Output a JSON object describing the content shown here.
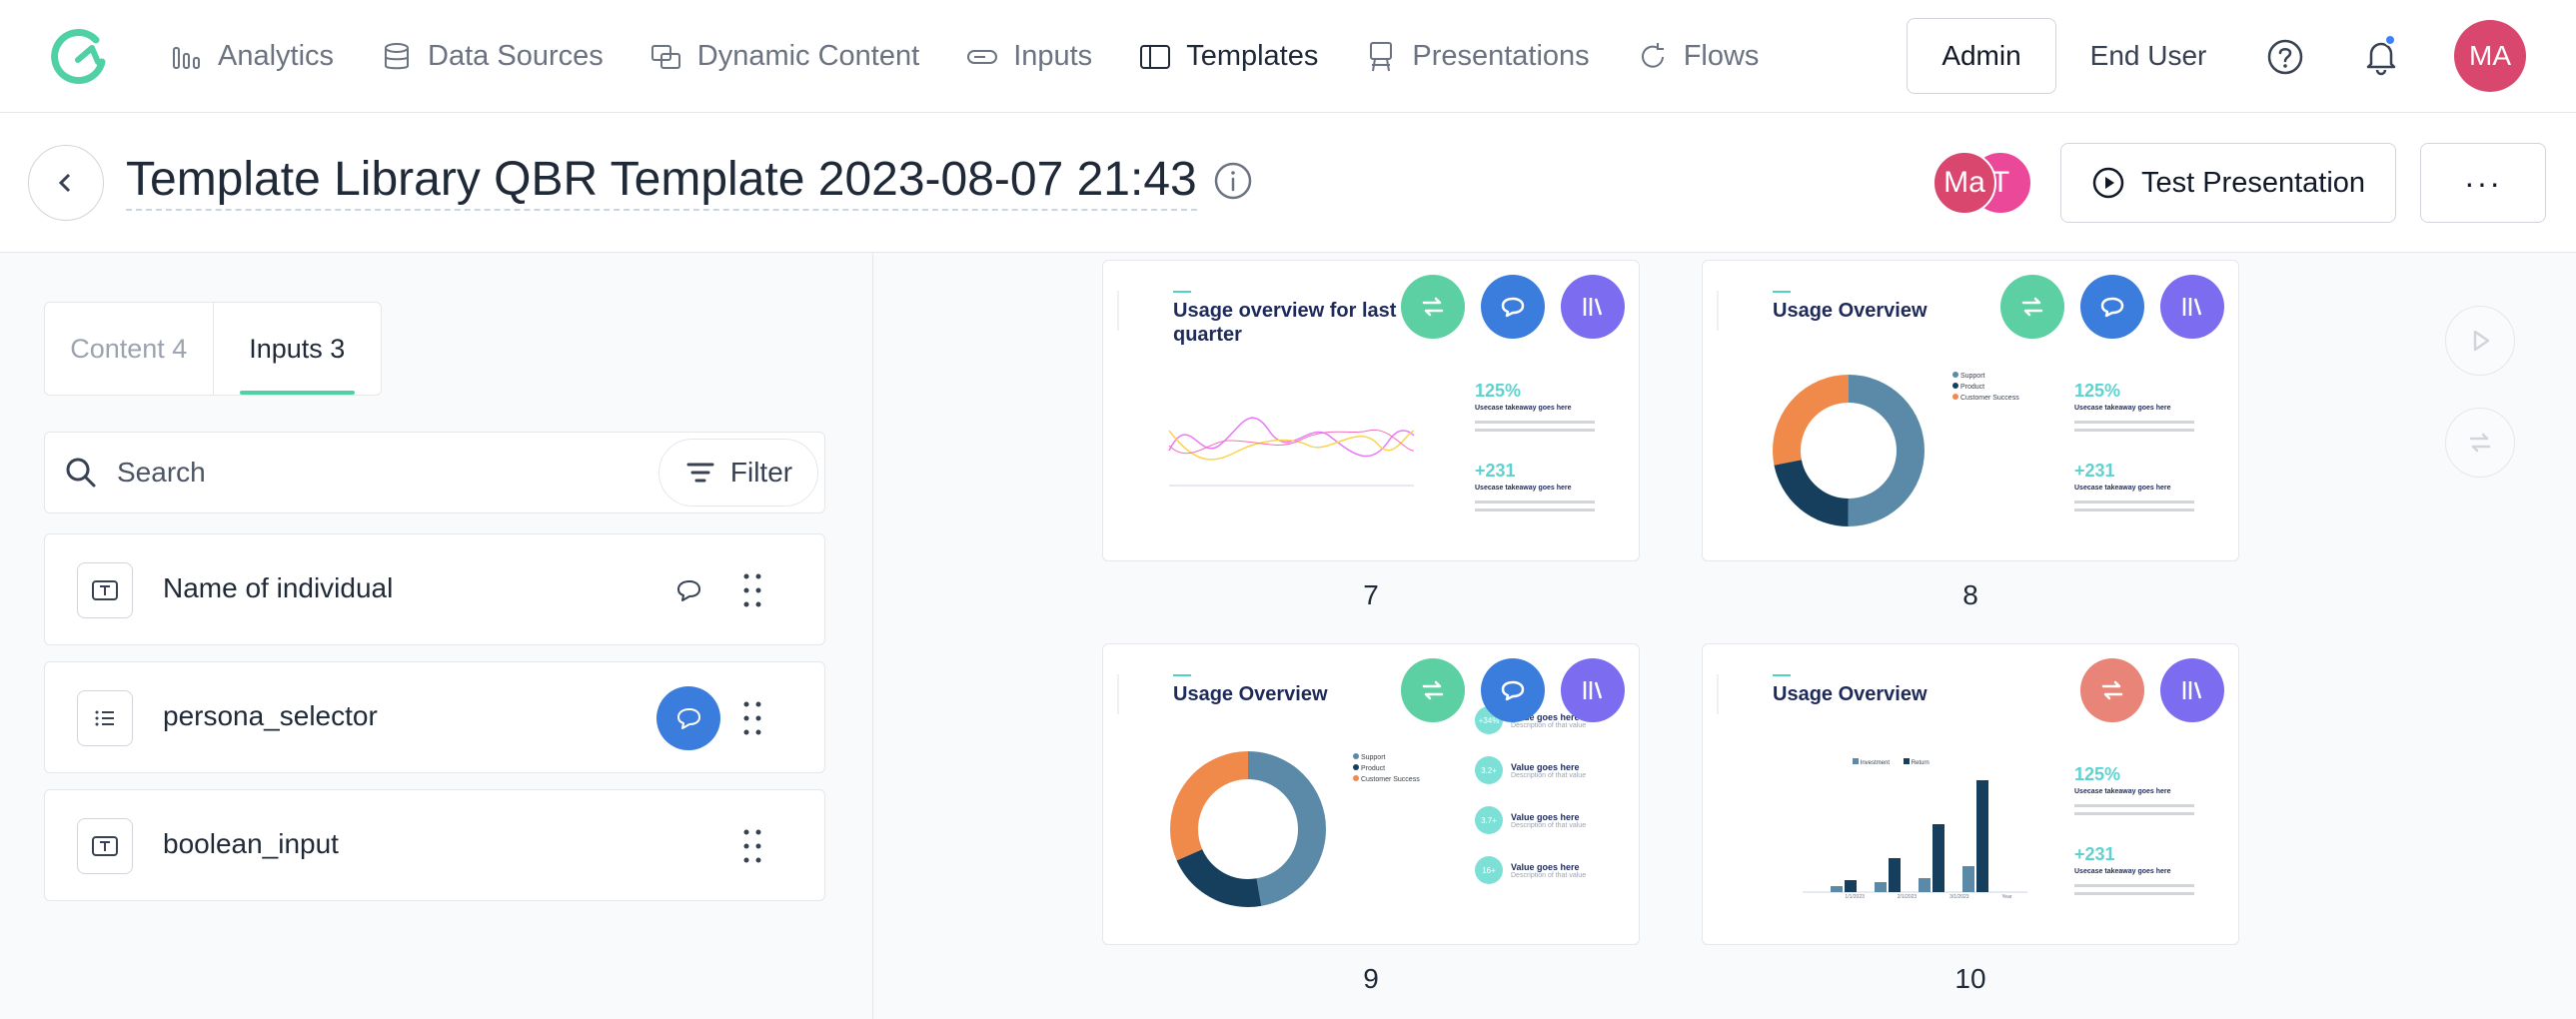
{
  "nav": {
    "items": [
      {
        "label": "Analytics",
        "icon": "analytics-icon"
      },
      {
        "label": "Data Sources",
        "icon": "database-icon"
      },
      {
        "label": "Dynamic Content",
        "icon": "dynamic-content-icon"
      },
      {
        "label": "Inputs",
        "icon": "inputs-icon"
      },
      {
        "label": "Templates",
        "icon": "templates-icon",
        "active": true
      },
      {
        "label": "Presentations",
        "icon": "presentations-icon"
      },
      {
        "label": "Flows",
        "icon": "flows-icon"
      }
    ],
    "admin_label": "Admin",
    "enduser_label": "End User",
    "user_initials": "MA",
    "colors": {
      "brand": "#4fd1a5",
      "avatar": "#d9476e",
      "notification": "#3b82f6"
    }
  },
  "header": {
    "title": "Template Library QBR Template 2023-08-07 21:43",
    "collaborators": [
      "Ma",
      "T"
    ],
    "test_label": "Test Presentation",
    "more_label": "···"
  },
  "sidebar": {
    "tabs": [
      {
        "label": "Content 4",
        "active": false
      },
      {
        "label": "Inputs 3",
        "active": true
      }
    ],
    "search_placeholder": "Search",
    "filter_label": "Filter",
    "inputs": [
      {
        "label": "Name of individual",
        "type": "text-icon",
        "has_action": true,
        "action_active": false
      },
      {
        "label": "persona_selector",
        "type": "list-icon",
        "has_action": true,
        "action_active": true
      },
      {
        "label": "boolean_input",
        "type": "text-icon",
        "has_action": false,
        "action_active": false
      }
    ]
  },
  "slides": [
    {
      "number": "7",
      "title": "Usage overview for last quarter",
      "metrics": [
        "125%",
        "+231"
      ],
      "metric_caption": "Usecase takeaway goes here",
      "buttons": [
        "green",
        "blue",
        "purple"
      ]
    },
    {
      "number": "8",
      "title": "Usage Overview",
      "metrics": [
        "125%",
        "+231"
      ],
      "metric_caption": "Usecase takeaway goes here",
      "legend": [
        "Support",
        "Product",
        "Customer Success"
      ],
      "buttons": [
        "green",
        "blue",
        "purple"
      ]
    },
    {
      "number": "9",
      "title": "Usage Overview",
      "legend": [
        "Support",
        "Product",
        "Customer Success"
      ],
      "values_caption": "Value goes here",
      "values_sub": "Description of that value",
      "bubbles": [
        "+34%",
        "3.2+",
        "3.7+",
        "16+"
      ],
      "buttons": [
        "green",
        "blue",
        "purple"
      ]
    },
    {
      "number": "10",
      "title": "Usage Overview",
      "metrics": [
        "125%",
        "+231"
      ],
      "metric_caption": "Usecase takeaway goes here",
      "chart_legend": [
        "Investment",
        "Return"
      ],
      "chart_categories": [
        "1/1/2023",
        "2/1/2023",
        "3/1/2023",
        "Year"
      ],
      "buttons": [
        "red",
        "purple"
      ]
    }
  ],
  "colors": {
    "donut": [
      "#5b8aa8",
      "#163f5e",
      "#f08a4b"
    ],
    "metric": "#5cd3d1",
    "slide_title": "#1e2a5a"
  }
}
